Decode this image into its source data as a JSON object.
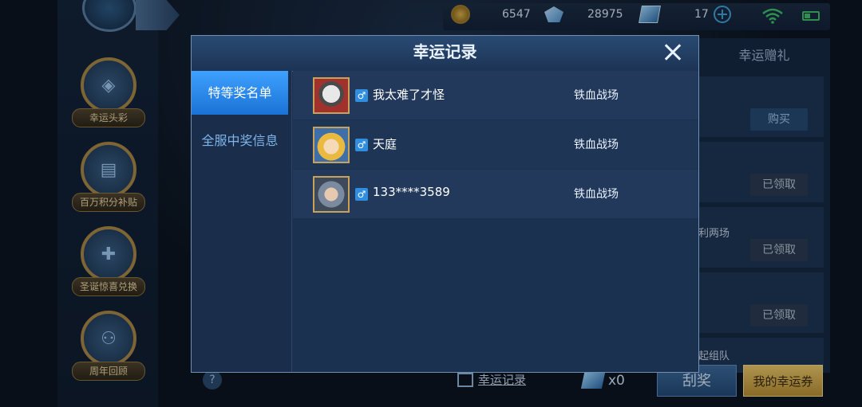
{
  "status": {
    "coins": "6547",
    "diamonds": "28975",
    "tickets": "17"
  },
  "left_activities": [
    {
      "label": "幸运头彩"
    },
    {
      "label": "百万积分补贴"
    },
    {
      "label": "圣诞惊喜兑换"
    },
    {
      "label": "周年回顾"
    }
  ],
  "right_panel": {
    "tab": "幸运赠礼",
    "buy_label": "购买",
    "claimed_label": "已领取",
    "text_row3": "利两场",
    "text_row5": "起组队"
  },
  "modal": {
    "title": "幸运记录",
    "tabs": [
      {
        "label": "特等奖名单"
      },
      {
        "label": "全服中奖信息"
      }
    ],
    "gender_symbol": "♂",
    "rows": [
      {
        "name": "我太难了才怪",
        "mode": "铁血战场"
      },
      {
        "name": "天庭",
        "mode": "铁血战场"
      },
      {
        "name": "133****3589",
        "mode": "铁血战场"
      }
    ]
  },
  "bottom": {
    "help": "?",
    "record_link": "幸运记录",
    "ticket_count": "x0",
    "scratch_button": "刮奖",
    "my_coupons_button": "我的幸运券"
  }
}
